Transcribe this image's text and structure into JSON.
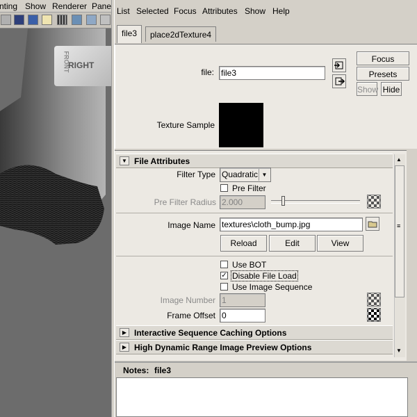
{
  "viewport": {
    "menu": [
      "nting",
      "Show",
      "Renderer",
      "Panel"
    ],
    "cube_label": "RIGHT",
    "cube_side_label": "FRONT"
  },
  "attr_editor": {
    "menu": [
      "List",
      "Selected",
      "Focus",
      "Attributes",
      "Show",
      "Help"
    ],
    "tabs": [
      "file3",
      "place2dTexture4"
    ],
    "file_label": "file:",
    "file_value": "file3",
    "buttons": {
      "focus": "Focus",
      "presets": "Presets",
      "show": "Show",
      "hide": "Hide"
    },
    "texture_sample_label": "Texture Sample",
    "sections": {
      "file_attributes": "File Attributes",
      "interactive": "Interactive Sequence Caching Options",
      "hdr": "High Dynamic Range Image Preview Options"
    },
    "filter_type_label": "Filter Type",
    "filter_type_value": "Quadratic",
    "pre_filter_label": "Pre Filter",
    "pre_filter_radius_label": "Pre Filter Radius",
    "pre_filter_radius_value": "2.000",
    "image_name_label": "Image Name",
    "image_name_value": "textures\\cloth_bump.jpg",
    "reload": "Reload",
    "edit": "Edit",
    "view": "View",
    "use_bot": "Use BOT",
    "disable_file_load": "Disable File Load",
    "use_image_sequence": "Use Image Sequence",
    "image_number_label": "Image Number",
    "image_number_value": "1",
    "frame_offset_label": "Frame Offset",
    "frame_offset_value": "0",
    "notes_label": "Notes:",
    "notes_node": "file3"
  },
  "colors": {
    "panel_bg": "#d4d0c8",
    "viewport_bg": "#6f6f6f",
    "button_bg": "#ece9e3"
  }
}
